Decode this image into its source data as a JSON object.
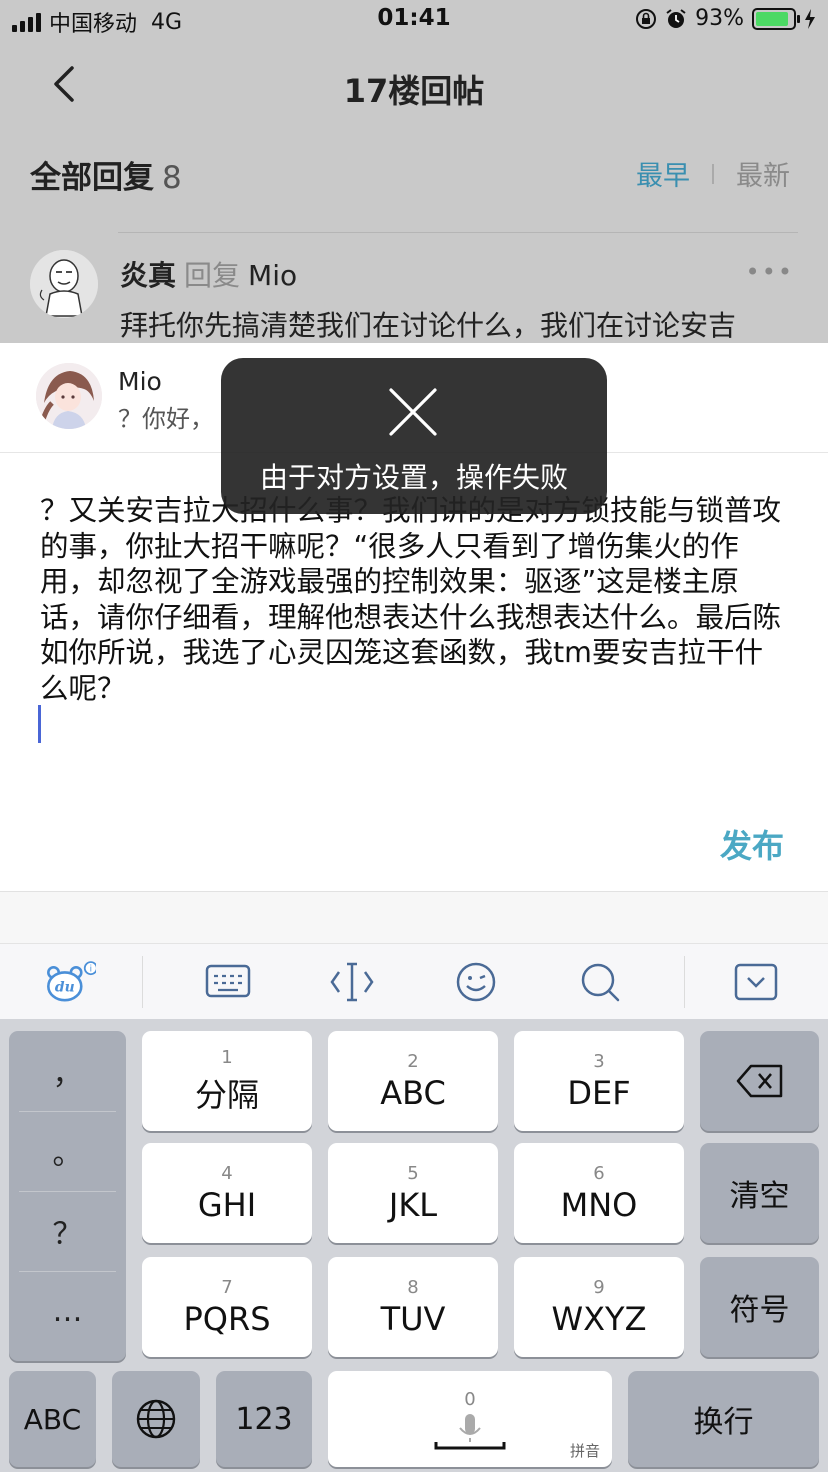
{
  "status_bar": {
    "carrier": "中国移动",
    "network": "4G",
    "time": "01:41",
    "battery": "93%"
  },
  "header": {
    "title": "17楼回帖"
  },
  "replies": {
    "label": "全部回复",
    "count": "8",
    "sort_earliest": "最早",
    "sort_latest": "最新"
  },
  "reply": {
    "author": "炎真",
    "verb": "回复",
    "target": "Mio",
    "more": "•••",
    "text": "拜托你先搞清楚我们在讨论什么，我们在讨论安吉"
  },
  "quote": {
    "name": "Mio",
    "text": "？你好，"
  },
  "editor": {
    "text": "？又关安吉拉大招什么事？我们讲的是对方锁技能与锁普攻的事，你扯大招干嘛呢？“很多人只看到了增伤集火的作用，却忽视了全游戏最强的控制效果：驱逐”这是楼主原话，请你仔细看，理解他想表达什么我想表达什么。最后陈如你所说，我选了心灵囚笼这套函数，我tm要安吉拉干什么呢？"
  },
  "publish_label": "发布",
  "toast": {
    "message": "由于对方设置，操作失败",
    "icon": "close-icon"
  },
  "toolbar": {
    "icons": [
      "du-logo-icon",
      "keyboard-icon",
      "cursor-icon",
      "emoji-icon",
      "search-icon",
      "collapse-icon"
    ],
    "badge": "i"
  },
  "keyboard": {
    "punctuation": [
      "，",
      "。",
      "？",
      "…"
    ],
    "keys": [
      {
        "num": "1",
        "label": "分隔"
      },
      {
        "num": "2",
        "label": "ABC"
      },
      {
        "num": "3",
        "label": "DEF"
      },
      {
        "num": "4",
        "label": "GHI"
      },
      {
        "num": "5",
        "label": "JKL"
      },
      {
        "num": "6",
        "label": "MNO"
      },
      {
        "num": "7",
        "label": "PQRS"
      },
      {
        "num": "8",
        "label": "TUV"
      },
      {
        "num": "9",
        "label": "WXYZ"
      }
    ],
    "clear": "清空",
    "symbols": "符号",
    "abc": "ABC",
    "numbers": "123",
    "space_num": "0",
    "space_hint": "拼音",
    "return": "换行"
  }
}
